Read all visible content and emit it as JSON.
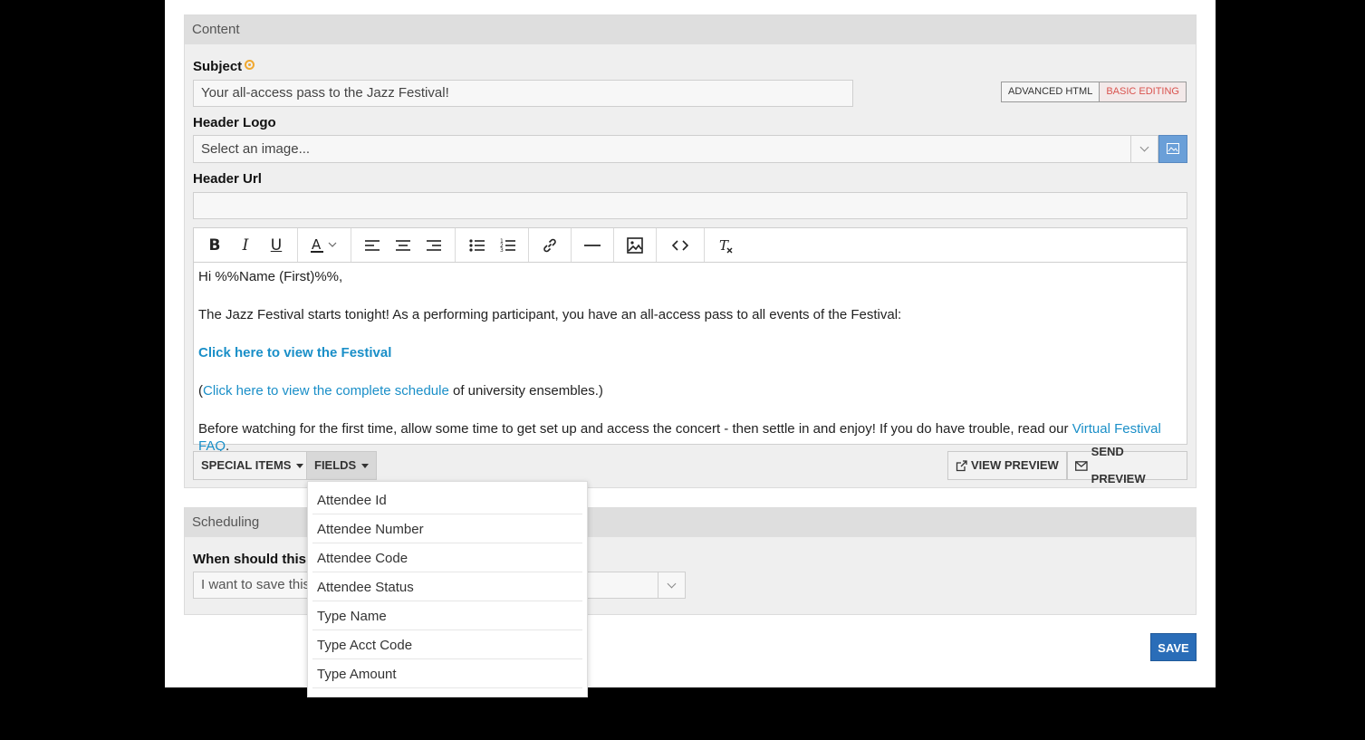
{
  "content": {
    "section_title": "Content",
    "subject": {
      "label": "Subject",
      "value": "Your all-access pass to the Jazz Festival!"
    },
    "mode_toggle": {
      "advanced": "ADVANCED HTML",
      "basic": "BASIC EDITING"
    },
    "header_logo": {
      "label": "Header Logo",
      "placeholder": "Select an image..."
    },
    "header_url": {
      "label": "Header Url",
      "value": ""
    },
    "editor": {
      "line1": "Hi %%Name (First)%%,",
      "line2": "The  Jazz Festival starts tonight! As a performing participant, you have an all-access pass to all events of the Festival:",
      "line3_link": "Click here to view the Festival",
      "line4_open": "(",
      "line4_link": "Click here to view the complete schedule",
      "line4_rest": " of university ensembles.)",
      "line5_text": "Before watching for the first time, allow some time to get set up and access the concert - then settle in and enjoy! If you do have trouble, read our ",
      "line5_link": "Virtual Festival FAQ",
      "line5_end": "."
    },
    "buttons": {
      "special_items": "SPECIAL ITEMS",
      "fields": "FIELDS",
      "view_preview": "VIEW PREVIEW",
      "send_preview": "SEND PREVIEW"
    }
  },
  "fields_dropdown": {
    "items": [
      "Attendee Id",
      "Attendee Number",
      "Attendee Code",
      "Attendee Status",
      "Type Name",
      "Type Acct Code",
      "Type Amount"
    ]
  },
  "scheduling": {
    "section_title": "Scheduling",
    "question_label": "When should this e",
    "select_value": "I want to save this"
  },
  "save_label": "SAVE",
  "colors": {
    "link": "#1a8fc8",
    "save": "#2a6db8",
    "required": "#f0a830",
    "active_mode": "#d9534f"
  }
}
